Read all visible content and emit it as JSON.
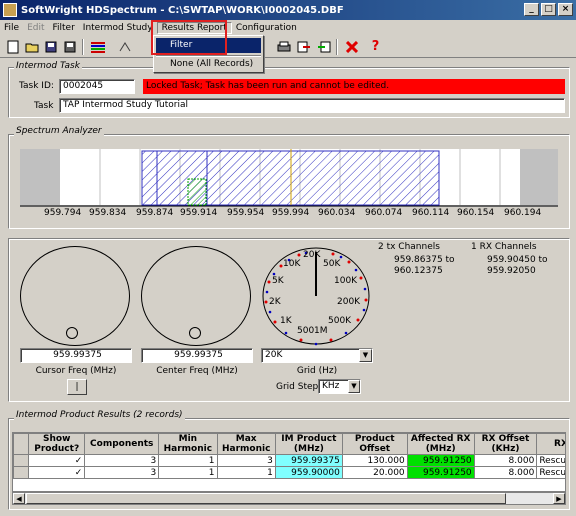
{
  "window": {
    "title": "SoftWright HDSpectrum - C:\\SWTAP\\WORK\\I0002045.DBF"
  },
  "menu": [
    "File",
    "Edit",
    "Filter",
    "Intermod Study",
    "Results Report",
    "Configuration"
  ],
  "dropdown": {
    "items": [
      "Filter",
      "None (All Records)"
    ]
  },
  "task": {
    "group_label": "Intermod Task",
    "id_label": "Task ID:",
    "id_value": "0002045",
    "locked_msg": "Locked Task; Task has been run and cannot be edited.",
    "task_label": "Task",
    "task_value": "TAP Intermod Study Tutorial"
  },
  "spectrum": {
    "group_label": "Spectrum Analyzer",
    "ticks": [
      "959.794",
      "959.834",
      "959.874",
      "959.914",
      "959.954",
      "959.994",
      "960.034",
      "960.074",
      "960.114",
      "960.154",
      "960.194"
    ]
  },
  "controls": {
    "cursor_freq": "959.99375",
    "cursor_label": "Cursor Freq (MHz)",
    "center_freq": "959.99375",
    "center_label": "Center Freq (MHz)",
    "grid_value": "20K",
    "grid_label": "Grid (Hz)",
    "grid_step_label": "Grid Step",
    "grid_step_value": "KHz",
    "dial_labels": [
      "20K",
      "10K",
      "50K",
      "5K",
      "100K",
      "2K",
      "200K",
      "1K",
      "500K",
      "500",
      "1M"
    ],
    "tx_channels_title": "2 tx Channels",
    "tx_range": "959.86375 to",
    "tx_range2": "960.12375",
    "rx_channels_title": "1 RX Channels",
    "rx_range": "959.90450 to",
    "rx_range2": "959.92050",
    "button_label": "|"
  },
  "results": {
    "group_label": "Intermod Product Results (2 records)",
    "headers": [
      "Show Product?",
      "Components",
      "Min Harmonic",
      "Max Harmonic",
      "IM Product (MHz)",
      "Product Offset",
      "Affected RX (MHz)",
      "RX Offset (KHz)",
      "RX Desc"
    ],
    "rows": [
      [
        "✓",
        "3",
        "1",
        "3",
        "959.99375",
        "130.000",
        "959.91250",
        "8.000",
        "Rescue"
      ],
      [
        "✓",
        "3",
        "1",
        "1",
        "959.90000",
        "20.000",
        "959.91250",
        "8.000",
        "Rescue"
      ]
    ]
  },
  "colors": {
    "locked_bg": "#ff0000",
    "im_product": "#80ffff",
    "affected_rx": "#00e000",
    "hatch": "#3030c0"
  }
}
